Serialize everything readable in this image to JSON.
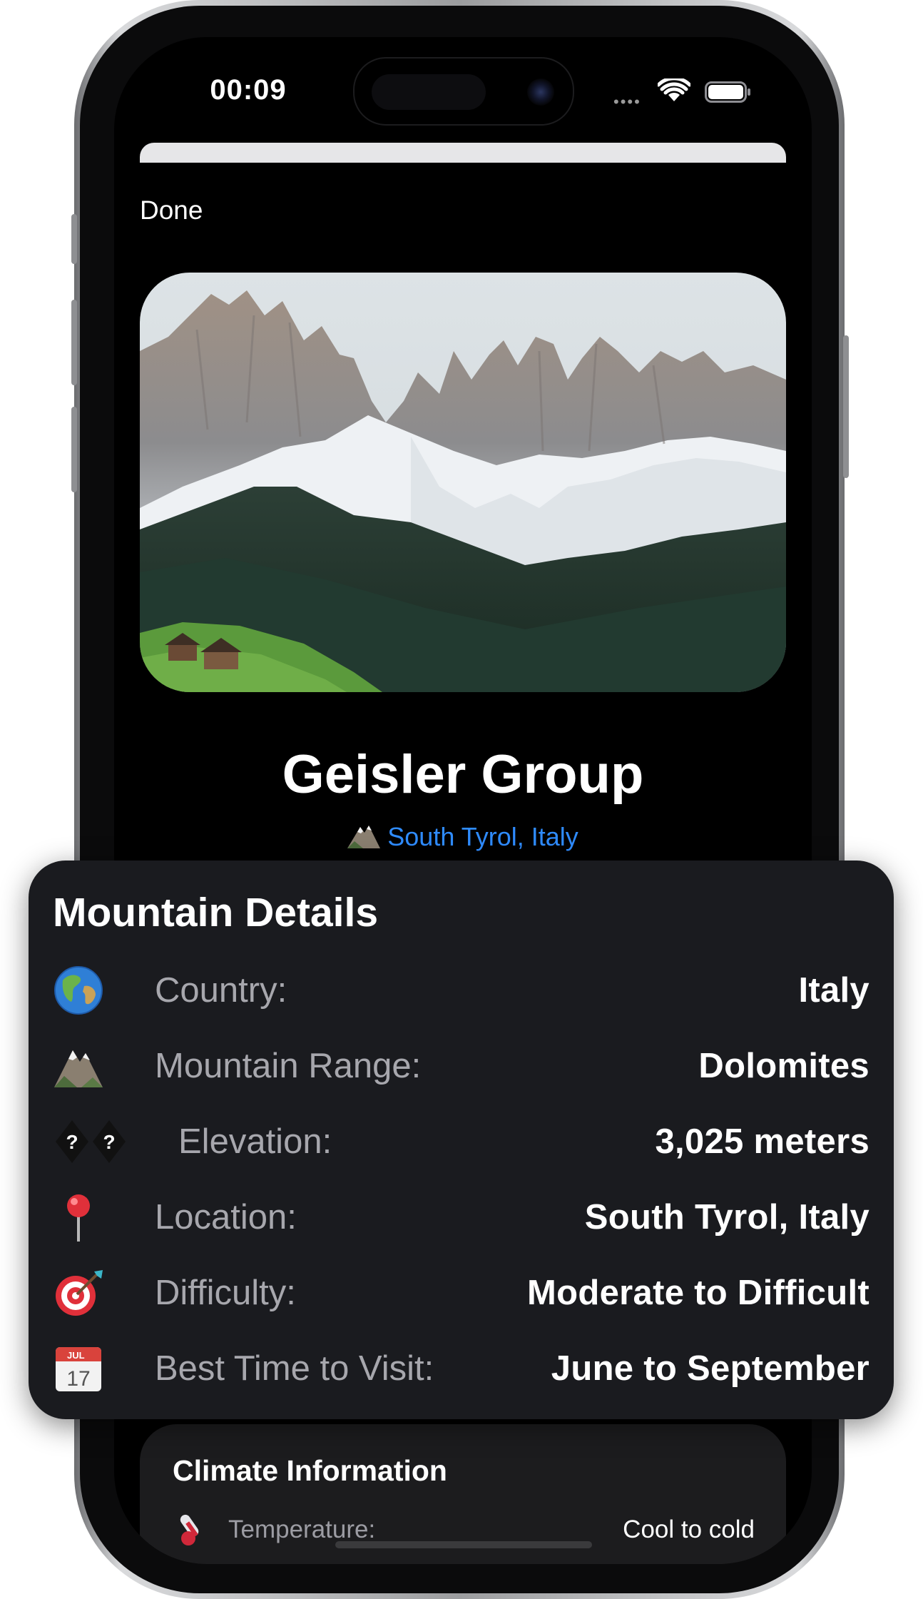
{
  "status_bar": {
    "time": "00:09"
  },
  "sheet": {
    "done_label": "Done"
  },
  "mountain": {
    "name": "Geisler Group",
    "region_link": "South Tyrol, Italy"
  },
  "details": {
    "title": "Mountain Details",
    "rows": [
      {
        "icon": "globe-icon",
        "label": "Country:",
        "value": "Italy"
      },
      {
        "icon": "mountain-icon",
        "label": "Mountain Range:",
        "value": "Dolomites"
      },
      {
        "icon": "unknown-glyph-icon",
        "label": "Elevation:",
        "value": "3,025 meters"
      },
      {
        "icon": "pin-icon",
        "label": "Location:",
        "value": "South Tyrol, Italy"
      },
      {
        "icon": "target-icon",
        "label": "Difficulty:",
        "value": "Moderate to Difficult"
      },
      {
        "icon": "calendar-icon",
        "label": "Best Time to Visit:",
        "value": "June to September"
      }
    ]
  },
  "calendar_icon": {
    "month": "JUL",
    "day": "17"
  },
  "climate": {
    "title": "Climate Information",
    "rows": [
      {
        "icon": "thermometer-icon",
        "label": "Temperature:",
        "value": "Cool to cold"
      }
    ]
  },
  "colors": {
    "accent_link": "#2f8cff",
    "card_bg": "#1a1b1f"
  }
}
